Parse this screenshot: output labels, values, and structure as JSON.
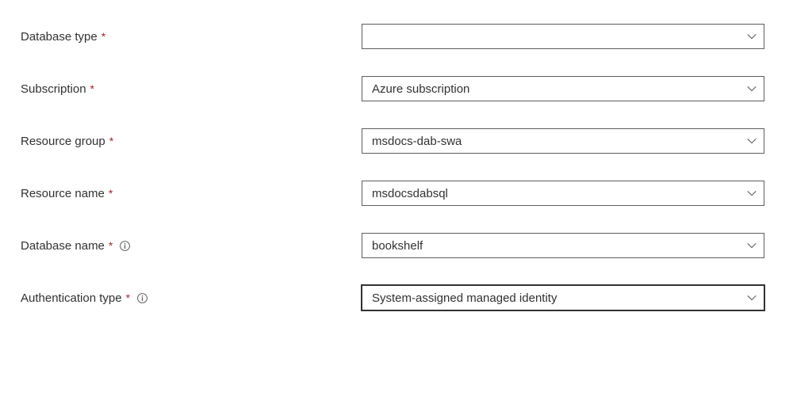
{
  "fields": {
    "databaseType": {
      "label": "Database type",
      "value": "",
      "required": true,
      "info": false
    },
    "subscription": {
      "label": "Subscription",
      "value": "Azure subscription",
      "required": true,
      "info": false
    },
    "resourceGroup": {
      "label": "Resource group",
      "value": "msdocs-dab-swa",
      "required": true,
      "info": false
    },
    "resourceName": {
      "label": "Resource name",
      "value": "msdocsdabsql",
      "required": true,
      "info": false
    },
    "databaseName": {
      "label": "Database name",
      "value": "bookshelf",
      "required": true,
      "info": true
    },
    "authenticationType": {
      "label": "Authentication type",
      "value": "System-assigned managed identity",
      "required": true,
      "info": true,
      "focused": true
    }
  },
  "symbols": {
    "requiredMark": "*"
  }
}
